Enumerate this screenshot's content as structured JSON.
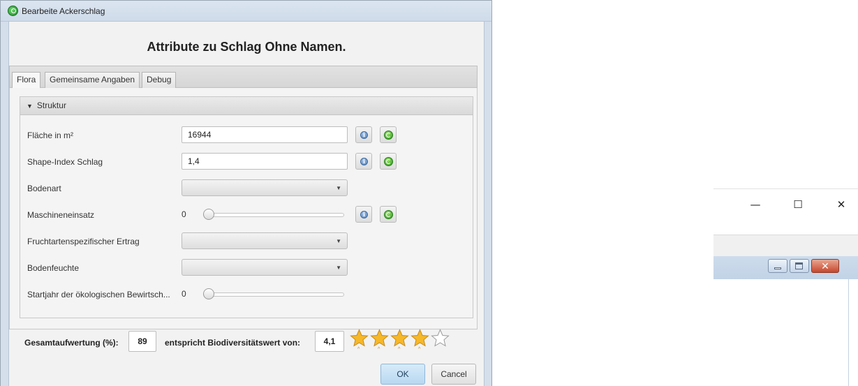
{
  "window": {
    "title": "Bearbeite Ackerschlag"
  },
  "heading": "Attribute zu Schlag Ohne Namen.",
  "tabs": [
    {
      "label": "Flora",
      "active": true
    },
    {
      "label": "Gemeinsame Angaben",
      "active": false
    },
    {
      "label": "Debug",
      "active": false
    }
  ],
  "pane": {
    "title": "Struktur",
    "expanded": true
  },
  "fields": {
    "flaeche": {
      "label": "Fläche in m²",
      "value": "16944"
    },
    "shape_index": {
      "label": "Shape-Index Schlag",
      "value": "1,4"
    },
    "bodenart": {
      "label": "Bodenart",
      "selected": ""
    },
    "maschineneinsatz": {
      "label": "Maschineneinsatz",
      "value": "0",
      "slider_fraction": 0
    },
    "ertrag": {
      "label": "Fruchtartenspezifischer Ertrag",
      "selected": ""
    },
    "bodenfeuchte": {
      "label": "Bodenfeuchte",
      "selected": ""
    },
    "startjahr": {
      "label": "Startjahr der ökologischen Bewirtsch...",
      "value": "0",
      "slider_fraction": 0
    }
  },
  "icons": {
    "info": "info-icon",
    "refresh": "refresh-icon"
  },
  "summary": {
    "gesamt_label": "Gesamtaufwertung (%):",
    "gesamt_value": "89",
    "biodiv_label": "entspricht Biodiversitätswert von:",
    "biodiv_value": "4,1",
    "stars_filled": 4,
    "stars_total": 5
  },
  "buttons": {
    "ok": "OK",
    "cancel": "Cancel"
  },
  "colors": {
    "star_fill": "#f5b82a",
    "star_empty": "#ffffff",
    "ok_button": "#b7d8f1",
    "close_red": "#c7472d"
  },
  "background_window": {
    "caption_buttons": {
      "minimize": "—",
      "maximize": "☐",
      "close": "✕"
    }
  }
}
